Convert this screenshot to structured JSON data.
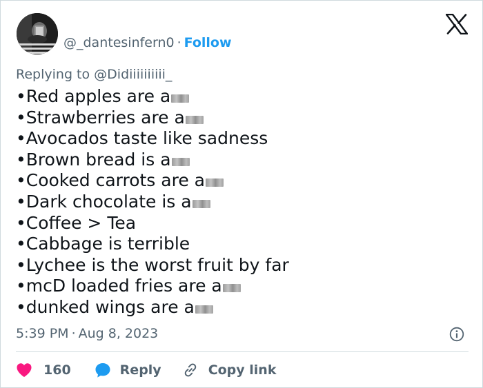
{
  "author": {
    "display_name": "",
    "handle": "@_dantesinfern0",
    "separator": "·",
    "follow_label": "Follow"
  },
  "reply_context": {
    "prefix": "Replying to",
    "mention": "@Didiiiiiiiiii_"
  },
  "tweet": {
    "bullet": "•",
    "lines": [
      {
        "text": "Red apples are a",
        "censored": true
      },
      {
        "text": "Strawberries are a",
        "censored": true
      },
      {
        "text": "Avocados taste like sadness",
        "censored": false
      },
      {
        "text": "Brown bread is a",
        "censored": true
      },
      {
        "text": "Cooked carrots are a",
        "censored": true
      },
      {
        "text": "Dark chocolate is a",
        "censored": true
      },
      {
        "text": "Coffee > Tea",
        "censored": false
      },
      {
        "text": "Cabbage is terrible",
        "censored": false
      },
      {
        "text": "Lychee is the worst fruit by far",
        "censored": false
      },
      {
        "text": "mcD loaded fries are a",
        "censored": true
      },
      {
        "text": "dunked wings are a",
        "censored": true
      }
    ]
  },
  "meta": {
    "time": "5:39 PM",
    "separator": "·",
    "date": "Aug 8, 2023"
  },
  "actions": {
    "like_count": "160",
    "reply_label": "Reply",
    "copy_link_label": "Copy link"
  },
  "icons": {
    "logo": "x-logo-icon",
    "info": "info-icon",
    "like": "heart-icon",
    "reply": "speech-bubble-icon",
    "copy": "link-icon"
  },
  "colors": {
    "text": "#0f1419",
    "secondary": "#536471",
    "accent": "#1d9bf0",
    "like": "#f91880",
    "border": "#cfd9de"
  }
}
